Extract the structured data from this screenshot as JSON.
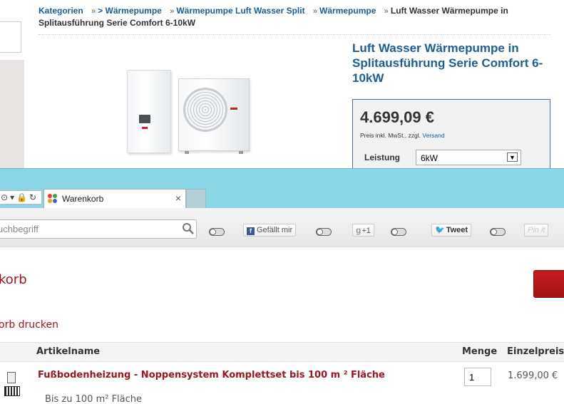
{
  "product_page": {
    "breadcrumb": {
      "items": [
        "Kategorien",
        "> Wärmepumpe",
        "Wärmepumpe Luft Wasser Split",
        "Wärmepumpe"
      ],
      "current": "Luft Wasser Wärmepumpe in Splitausführung Serie Comfort 6-10kW"
    },
    "product": {
      "title": "Luft Wasser Wärmepumpe in Splitausführung Serie Comfort 6-10kW",
      "price": "4.699,09 €",
      "price_note": "Preis inkl. MwSt., zzgl.",
      "shipping_link": "Versand",
      "option_label": "Leistung",
      "option_value": "6kW"
    }
  },
  "browser": {
    "tab_title": "Warenkorb",
    "tab_close": "×",
    "search_placeholder": "uchbegriff"
  },
  "social": {
    "facebook_label": "Gefällt mir",
    "gplus_label": "+1",
    "tweet_label": "Tweet",
    "pin_label": "Pin it"
  },
  "cart": {
    "heading": "korb",
    "print_link": "orb drucken",
    "columns": {
      "name": "Artikelname",
      "qty": "Menge",
      "unit_price": "Einzelpreis"
    },
    "items": [
      {
        "name": "Fußbodenheizung - Noppensystem Komplettset bis 100 m ² Fläche",
        "description": "Bis zu 100 m² Fläche",
        "qty": "1",
        "unit_price": "1.699,00 €"
      }
    ]
  },
  "colors": {
    "link_blue": "#1a5e9a",
    "cart_red": "#a0141e",
    "tabbar": "#8ad6e6",
    "price_box_border": "#4c6fa0"
  }
}
